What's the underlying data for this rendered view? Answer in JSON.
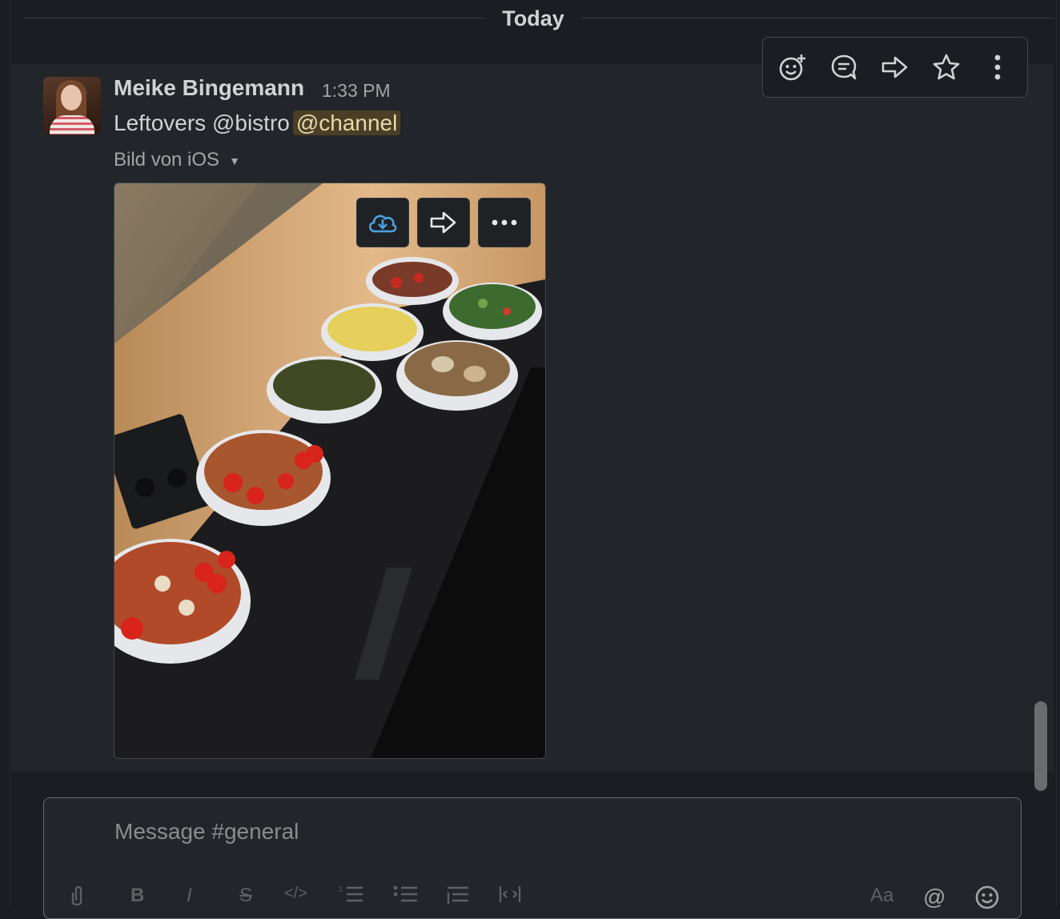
{
  "divider": {
    "label": "Today"
  },
  "message": {
    "author": "Meike Bingemann",
    "time": "1:33 PM",
    "text": "Leftovers @bistro",
    "mention": "@channel",
    "file_label": "Bild von iOS",
    "file_caret": "▼"
  },
  "image_actions": {
    "download_icon": "cloud-download-icon",
    "share_icon": "share-arrow-icon",
    "more_icon": "more-horizontal-icon"
  },
  "hover_toolbar": {
    "icons": [
      "add-reaction-icon",
      "reply-thread-icon",
      "share-message-icon",
      "save-star-icon",
      "more-vertical-icon"
    ]
  },
  "composer": {
    "placeholder": "Message #general",
    "format_icons": [
      "attach-icon",
      "bold-icon",
      "italic-icon",
      "strikethrough-icon",
      "code-icon",
      "ordered-list-icon",
      "bullet-list-icon",
      "blockquote-icon",
      "code-block-icon",
      "text-format-icon",
      "mention-icon",
      "emoji-icon"
    ],
    "labels": {
      "bold": "B",
      "italic": "I",
      "strike": "S",
      "code": "</>",
      "aa": "Aa",
      "at": "@"
    }
  },
  "colors": {
    "background": "#1a1d21",
    "message_hover": "#222529",
    "mention_bg": "#4a3f26",
    "download_accent": "#4aa3df"
  }
}
